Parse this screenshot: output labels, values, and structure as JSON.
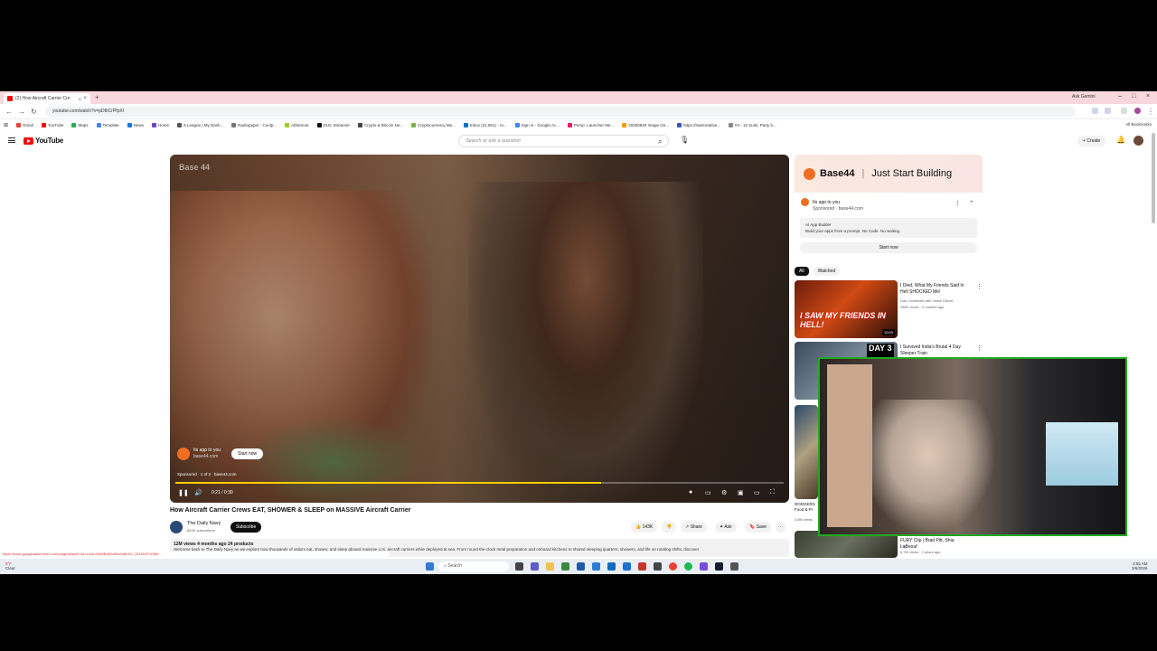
{
  "browser": {
    "tab_title": "(2) How Aircraft Carrier Cre",
    "tab_badge": "4",
    "ask_gemini": "Ask Gemini",
    "url": "youtube.com/watch?v=pD8iCrPfpXI",
    "bookmarks": [
      "Gmail",
      "YouTube",
      "Maps",
      "Template",
      "News",
      "Home",
      "Z League | My Dash...",
      "Radiopaper - Coolp...",
      "Abbetroot",
      "DUC Streamer",
      "Crypto & Bitcoin Ne...",
      "Cryptocurrency Me...",
      "Inbox (31,951) - ro...",
      "Sign in - Google Ac...",
      "Pump: Launcher Me...",
      "20250830 Image Ge...",
      "https://itsalcreative...",
      "#4 - 10 Suits, Party b..."
    ],
    "all_bookmarks": "All Bookmarks"
  },
  "youtube": {
    "logo": "YouTube",
    "search_placeholder": "Search or ask a question",
    "create": "Create",
    "notifications": "9+"
  },
  "player": {
    "watermark": "Base 44",
    "ad_title": "Its app to you",
    "ad_domain": "base44.com",
    "ad_button": "Start now",
    "sponsored": "Sponsored · 1 of 2 · base44.com",
    "time": "0:21 / 0:30",
    "progress": 0.7
  },
  "video": {
    "title": "How Aircraft Carrier Crews EAT, SHOWER & SLEEP on MASSIVE Aircraft Carrier",
    "channel": "The Daily Navy",
    "subscribers": "840K subscribers",
    "subscribe": "Subscribe",
    "likes": "143K",
    "share": "Share",
    "ask": "Ask",
    "save": "Save",
    "meta": "12M views  4 months ago  24 products",
    "description": "Welcome back to The Daily Navy as we explore how thousands of sailors eat, shower, and sleep aboard massive U.S. aircraft carriers while deployed at sea. From round-the-clock meal preparation and onboard kitchens to shared sleeping quarters, showers, and life on rotating shifts, discover"
  },
  "status_url": "https://www.googleadservices.com/pagead/aclk?sa=L&ai=DkWBqE6aRw0n8hXC_OiZbNVTiOM9...",
  "sidebar": {
    "ad_banner_brand": "Base44",
    "ad_banner_tagline": "Just Start Building",
    "ad_title": "Its app to you",
    "ad_sponsor": "Sponsored · base44.com",
    "ad_box_title": "AI App Builder",
    "ad_box_text": "Build your apps from a prompt. No Code. No waiting.",
    "ad_button": "Start now",
    "chips": [
      "All",
      "Watched"
    ],
    "recs": [
      {
        "title": "I Died, What My Friends Said In Hell SHOCKED Me!",
        "channel": "Dan Lucianists with Jesse Daniel",
        "meta": "286K views · 2 months ago",
        "duration": "10:03",
        "thumb_text": "I SAW MY FRIENDS IN HELL!"
      },
      {
        "title": "I Survived India's Brutal 4 Day Sleeper Train",
        "channel": "",
        "meta": "",
        "duration": "",
        "thumb_text": "DAY 3"
      },
      {
        "title": "DODGERS Food & Pr",
        "channel": "",
        "meta": "3.8M views",
        "duration": "",
        "thumb_text": ""
      },
      {
        "title": "FURY Clip | Brad Pitt, Shia LaBeouf",
        "channel": "Clip",
        "meta": "8.7M views · 2 years ago",
        "duration": "",
        "thumb_text": ""
      }
    ]
  },
  "taskbar": {
    "weather_temp": "8°F",
    "weather_desc": "Clear",
    "search": "Search",
    "time": "2:55 AM",
    "date": "3/6/2026"
  }
}
